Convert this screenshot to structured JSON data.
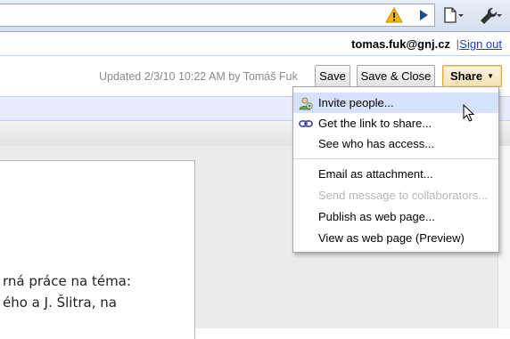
{
  "account": {
    "email": "tomas.fuk@gnj.cz",
    "separator": "|",
    "signout": "Sign out"
  },
  "header": {
    "updated": "Updated 2/3/10 10:22 AM by Tomáš Fuk",
    "save": "Save",
    "save_close": "Save & Close",
    "share": "Share",
    "share_caret": "▼"
  },
  "share_menu": {
    "items": [
      {
        "label": "Invite people...",
        "icon": "invite-people-icon",
        "state": "hover"
      },
      {
        "label": "Get the link to share...",
        "icon": "link-icon"
      },
      {
        "label": "See who has access..."
      },
      {
        "label": "Email as attachment..."
      },
      {
        "label": "Send message to collaborators...",
        "state": "disabled"
      },
      {
        "label": "Publish as web page..."
      },
      {
        "label": "View as web page (Preview)"
      }
    ]
  },
  "document": {
    "lines": [
      "rná práce na téma:",
      "ého a J. Šlitra, na"
    ]
  },
  "colors": {
    "link": "#1a3fc7",
    "menu_hover": "#d6e2fb",
    "share_border": "#e0a94a",
    "warning": "#f2b50f"
  }
}
